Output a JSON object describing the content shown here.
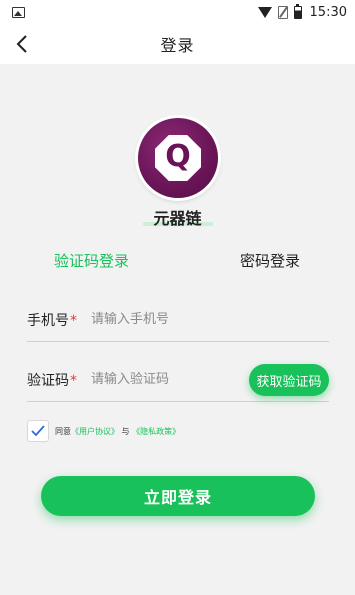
{
  "status_bar": {
    "time": "15:30",
    "icons": [
      "image-icon",
      "wifi-icon",
      "sim-icon",
      "battery-icon"
    ]
  },
  "nav": {
    "title": "登录",
    "back_icon": "chevron-left-icon"
  },
  "app": {
    "logo_letter": "Q",
    "name": "元器链"
  },
  "tabs": {
    "sms_label": "验证码登录",
    "password_label": "密码登录",
    "active": "sms"
  },
  "form": {
    "phone_label": "手机号",
    "phone_placeholder": "请输入手机号",
    "code_label": "验证码",
    "code_placeholder": "请输入验证码",
    "required_mark": "*",
    "get_code_label": "获取验证码"
  },
  "agreement": {
    "checked": true,
    "prefix": "同意",
    "user_agreement": "《用户协议》",
    "joiner": "与",
    "privacy_policy": "《隐私政策》"
  },
  "login_button": "立即登录",
  "colors": {
    "accent": "#19c15a",
    "logo_purple": "#6a1458",
    "required": "#e53935",
    "background": "#f2f2f2"
  }
}
